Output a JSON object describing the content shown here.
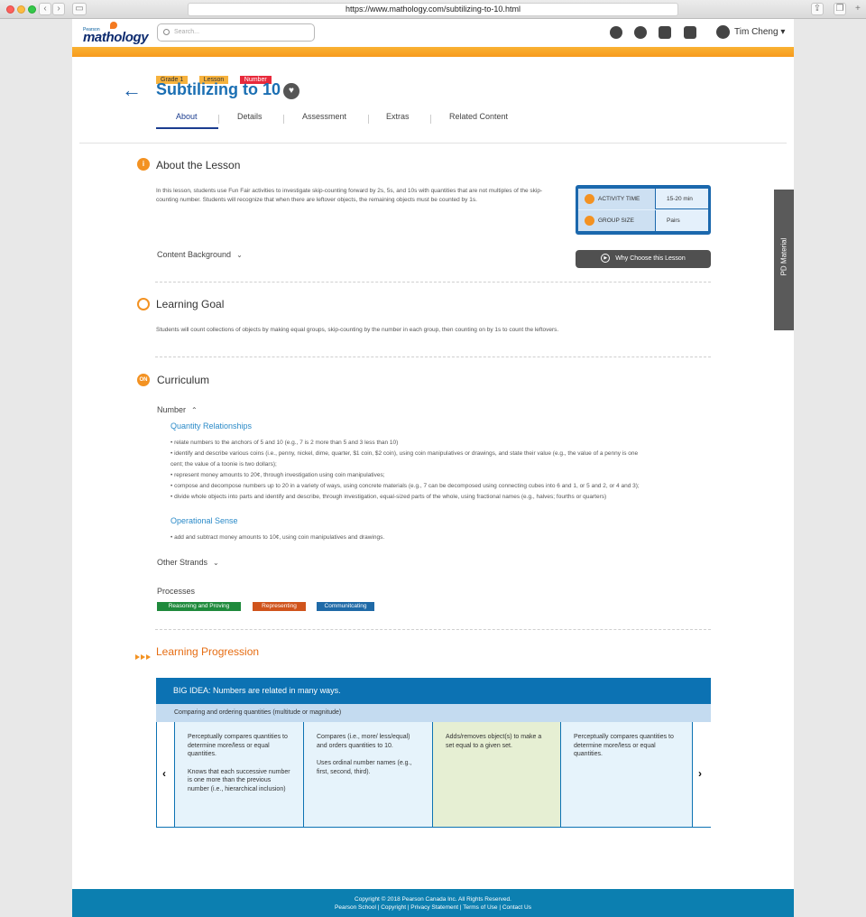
{
  "browser": {
    "url": "https://www.mathology.com/subtilizing-to-10.html"
  },
  "header": {
    "logo_small": "Pearson",
    "logo": "mathology",
    "search_placeholder": "Search...",
    "user_name": "Tim Cheng",
    "user_caret": "▾"
  },
  "lesson": {
    "tags": [
      {
        "label": "Grade 1",
        "color": "#f6b23d"
      },
      {
        "label": "Lesson",
        "color": "#f6b23d"
      },
      {
        "label": "Number",
        "color": "#e8293b"
      }
    ],
    "title": "Subtilizing to 10",
    "tabs": [
      "About",
      "Details",
      "Assessment",
      "Extras",
      "Related Content"
    ]
  },
  "about": {
    "heading": "About the Lesson",
    "icon": "i",
    "text": "In this lesson, students use Fun Fair activities to investigate skip-counting forward by 2s, 5s, and 10s with quantities that are not multiples of the skip-counting number. Students will recognize that when there are leftover objects, the remaining objects must be counted by 1s.",
    "activity_label": "ACTIVITY TIME",
    "activity_value": "15-20 min",
    "group_label": "GROUP SIZE",
    "group_value": "Pairs",
    "content_background": "Content Background",
    "why_button": "Why Choose this Lesson"
  },
  "pd_tab": "PD Material",
  "goal": {
    "heading": "Learning Goal",
    "text": "Students will count collections of objects by making equal groups, skip-counting by the number in each group, then counting on by 1s to count the leftovers."
  },
  "curriculum": {
    "heading": "Curriculum",
    "icon": "ON",
    "number_label": "Number",
    "qr_heading": "Quantity Relationships",
    "qr_bullets": [
      "• relate numbers to the anchors of 5 and 10 (e.g., 7 is 2 more than 5 and 3 less than 10)",
      "• identify and describe various coins (i.e., penny, nickel, dime, quarter, $1 coin, $2 coin), using coin manipulatives or drawings, and state their value (e.g., the value of a penny is one",
      "cent; the value of a toonie is two dollars);",
      "• represent money amounts to 20¢, through investigation using coin manipulatives;",
      "• compose and decompose numbers up to 20 in a variety of ways, using concrete materials (e.g., 7 can be decomposed using connecting cubes into 6 and 1, or 5 and 2, or 4 and 3);",
      "• divide whole objects into parts and identify and describe, through investigation, equal-sized parts of the whole, using fractional names (e.g., halves; fourths or quarters)"
    ],
    "os_heading": "Operational Sense",
    "os_bullets": [
      "• add and subtract money amounts to 10¢, using coin manipulatives and drawings."
    ],
    "other_strands": "Other Strands",
    "processes_label": "Processes",
    "processes": [
      {
        "label": "Reasoning and Proving",
        "color": "#1f8a3c"
      },
      {
        "label": "Representing",
        "color": "#d0541c"
      },
      {
        "label": "Communitcating",
        "color": "#1f6aa7"
      }
    ]
  },
  "progression": {
    "heading": "Learning Progression",
    "big_idea": "BIG IDEA: Numbers are related in many ways.",
    "compare_row": "Comparing and ordering quantities (multitude or magnitude)",
    "cards": [
      {
        "p1": "Perceptually compares quantities to determine more/less or equal quantities.",
        "p2": "Knows that each successive number is one more than the previous number (i.e., hierarchical inclusion)",
        "bg": "#e6f3fb"
      },
      {
        "p1": "Compares (i.e., more/ less/equal) and orders quantities to 10.",
        "p2": "Uses ordinal number names (e.g., first, second, third).",
        "bg": "#e6f3fb"
      },
      {
        "p1": "Adds/removes object(s) to make a set equal to a given set.",
        "p2": "",
        "bg": "#e6efd3"
      },
      {
        "p1": "Perceptually compares quantities to determine more/less or equal quantities.",
        "p2": "",
        "bg": "#e6f3fb"
      }
    ],
    "prev": "‹",
    "next": "›"
  },
  "footer": {
    "line1": "Copyright © 2018 Pearson Canada Inc. All Rights Reserved.",
    "line2": "Pearson School | Copyright | Privacy Statement | Terms of Use | Contact Us"
  }
}
